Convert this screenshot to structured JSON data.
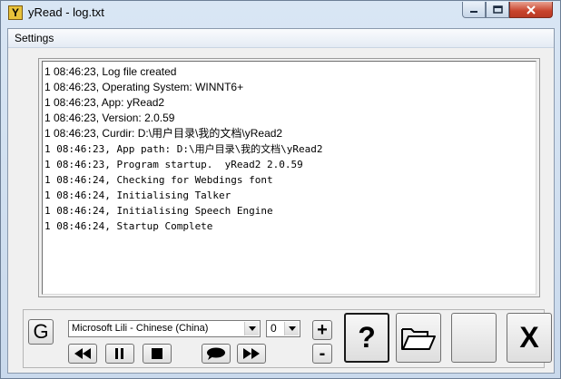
{
  "window": {
    "title": "yRead - log.txt",
    "app_icon_letter": "Y"
  },
  "menu": {
    "settings_label": "Settings"
  },
  "log": {
    "lines": [
      "1 08:46:23, Log file created",
      "1 08:46:23, Operating System: WINNT6+",
      "1 08:46:23, App: yRead2",
      "1 08:46:23, Version: 2.0.59",
      "1 08:46:23, Curdir: D:\\用户目录\\我的文档\\yRead2",
      "1 08:46:23, App path: D:\\用户目录\\我的文档\\yRead2",
      "1 08:46:23, Program startup.  yRead2 2.0.59",
      "1 08:46:24, Checking for Webdings font",
      "1 08:46:24, Initialising Talker",
      "1 08:46:24, Initialising Speech Engine",
      "1 08:46:24, Startup Complete"
    ]
  },
  "controls": {
    "g_label": "G",
    "voice_selected": "Microsoft Lili - Chinese (China)",
    "speed_selected": "0",
    "plus_label": "+",
    "minus_label": "-",
    "help_label": "?",
    "exit_label": "X"
  },
  "icons": {
    "rewind": "rewind-icon",
    "pause": "pause-icon",
    "stop": "stop-icon",
    "talk": "speech-bubble-icon",
    "fast_forward": "fast-forward-icon",
    "open": "open-folder-icon"
  }
}
